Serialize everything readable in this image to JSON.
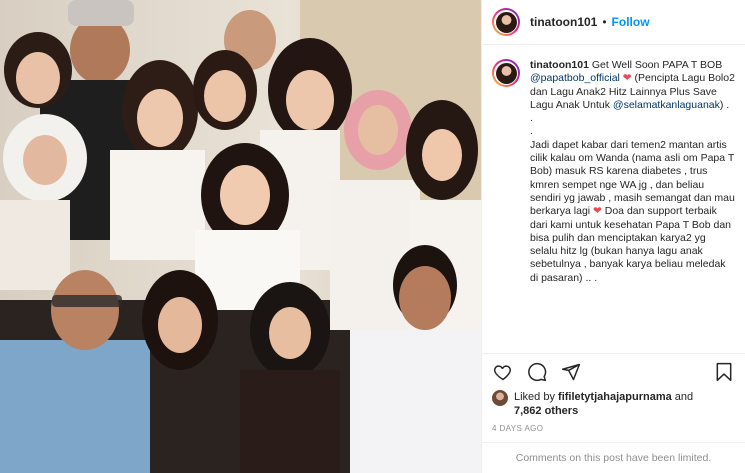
{
  "header": {
    "username": "tinatoon101",
    "separator": "•",
    "follow_label": "Follow"
  },
  "caption": {
    "username": "tinatoon101",
    "text_1": "Get Well Soon PAPA T BOB ",
    "mention_1": "@papatbob_official",
    "heart": "❤",
    "text_2": " (Pencipta Lagu Bolo2 dan Lagu Anak2 Hitz Lainnya Plus Save Lagu Anak Untuk ",
    "mention_2": "@selamatkanlaguanak",
    "text_3": ") .\n.\n.\nJadi dapet kabar dari temen2 mantan artis cilik kalau om Wanda (nama asli om Papa T Bob) masuk RS karena diabetes , trus kmren sempet nge WA jg , dan beliau sendiri yg jawab , masih semangat dan mau berkarya lagi ",
    "text_4": " Doa dan support terbaik dari kami untuk kesehatan Papa T Bob dan bisa pulih dan menciptakan karya2 yg selalu hitz lg (bukan hanya lagu anak sebetulnya , banyak karya beliau meledak di pasaran) .. ."
  },
  "actions": {
    "like_icon": "heart-outline-icon",
    "comment_icon": "comment-icon",
    "share_icon": "paper-plane-icon",
    "save_icon": "bookmark-icon"
  },
  "likes": {
    "prefix": "Liked by ",
    "user": "fifiletytjahajapurnama",
    "connector": " and",
    "count": "7,862 others"
  },
  "timestamp": "4 DAYS AGO",
  "comments_notice": "Comments on this post have been limited.",
  "colors": {
    "accent": "#0095f6",
    "heart": "#ed4956",
    "text": "#262626",
    "muted": "#8e8e8e",
    "border": "#efefef"
  }
}
